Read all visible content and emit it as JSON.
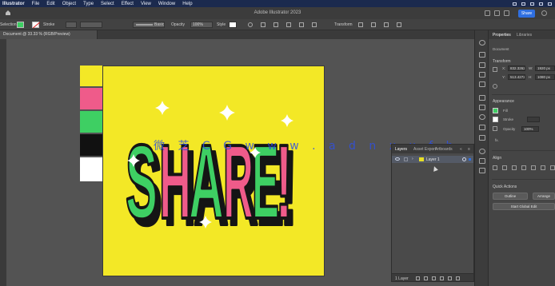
{
  "menubar": {
    "app": "Illustrator",
    "items": [
      "File",
      "Edit",
      "Object",
      "Type",
      "Select",
      "Effect",
      "View",
      "Window",
      "Help"
    ]
  },
  "titlebar": {
    "title": "Adobe Illustrator 2023",
    "share_label": "Share"
  },
  "controlbar": {
    "label": "Selection",
    "stroke_label": "Stroke",
    "brush_label": "Basic",
    "opacity_label": "Opacity",
    "opacity_value": "100%",
    "style_label": "Style",
    "transform_label": "Transform",
    "fill_color": "#3ecf63"
  },
  "document": {
    "tab_label": "Document @ 33.33 % (RGB/Preview)"
  },
  "swatches": [
    "#f3e826",
    "#ef5b8a",
    "#3ecf63",
    "#111111",
    "#ffffff"
  ],
  "artwork": {
    "word": "SHARE!",
    "background": "#f3e826",
    "colors": {
      "green": "#3ecf63",
      "pink": "#ef5b8a",
      "outline": "#151515",
      "sparkle": "#ffffff"
    }
  },
  "watermark": "微 芝 C G   w w w . a d n x x f b . c n",
  "layers_panel": {
    "tabs": [
      "Layers",
      "Asset Export",
      "Artboards"
    ],
    "layer_name": "Layer 1",
    "layer_count": "1 Layer"
  },
  "properties": {
    "tabs": [
      "Properties",
      "Libraries"
    ],
    "no_selection": "Document",
    "transform_title": "Transform",
    "x_label": "X:",
    "x_value": "832.3262",
    "y_label": "Y:",
    "y_value": "513.4272",
    "w_label": "W:",
    "w_value": "1920 px",
    "h_label": "H:",
    "h_value": "1080 px",
    "appearance_title": "Appearance",
    "fill_label": "Fill",
    "stroke_label": "Stroke",
    "opacity_label": "Opacity",
    "opacity_value": "100%",
    "fx_label": "fx.",
    "align_title": "Align",
    "quick_actions_title": "Quick Actions",
    "btn_outline": "Outline",
    "btn_arrange": "Arrange",
    "btn_start_global": "Start Global Edit"
  }
}
